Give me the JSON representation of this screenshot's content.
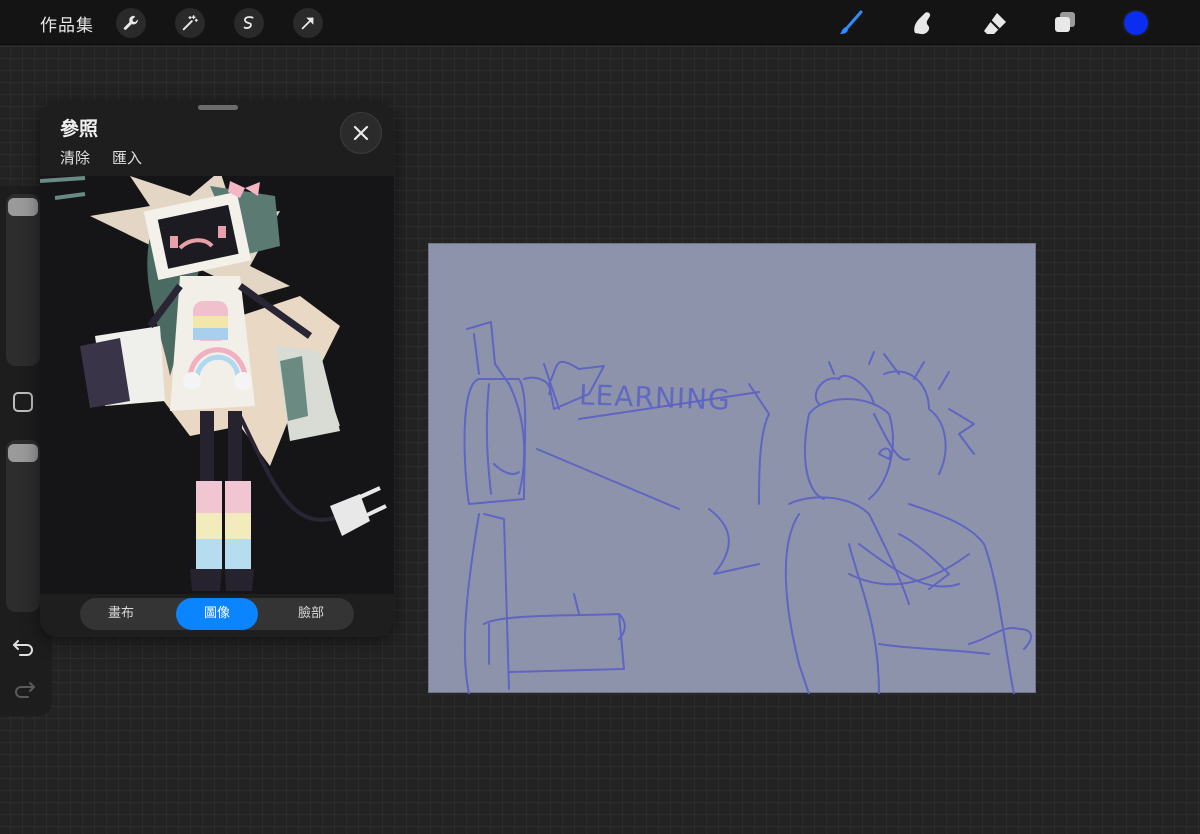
{
  "topbar": {
    "gallery_label": "作品集",
    "tools": [
      "wrench-icon",
      "magic-wand-icon",
      "selection-icon",
      "transform-arrow-icon"
    ],
    "right_tools": [
      "brush-icon",
      "smudge-icon",
      "eraser-icon",
      "layers-icon"
    ],
    "brush_color": "#0a2df0",
    "accent_color": "#2e8dfa"
  },
  "sidebar": {
    "undo_icon": "undo-icon",
    "redo_icon": "redo-icon"
  },
  "reference": {
    "title": "參照",
    "actions": [
      "清除",
      "匯入"
    ],
    "segments": [
      "畫布",
      "圖像",
      "臉部"
    ],
    "active_segment": "圖像"
  },
  "canvas": {
    "sketch_text": "LEARNING",
    "background_color": "#8e93ac",
    "line_color": "#5a61c4"
  }
}
